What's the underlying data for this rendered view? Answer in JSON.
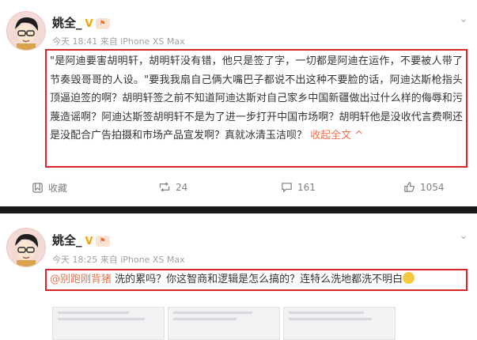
{
  "post1": {
    "username": "姚全_",
    "verified_badge": "V",
    "timestamp": "今天 18:41 来自 iPhone XS Max",
    "text": "\"是阿迪要害胡明轩，胡明轩没有错，他只是签了字，一切都是阿迪在运作，不要被人带了节奏毁哥哥的人设。\"要我我扇自己俩大嘴巴子都说不出这种不要脸的话，阿迪达斯枪指头顶逼迫签的啊？胡明轩签之前不知道阿迪达斯对自己家乡中国新疆做出过什么样的侮辱和污蔑造谣啊？阿迪达斯签胡明轩不是为了进一步打开中国市场啊？胡明轩他是没收代言费啊还是没配合广告拍摄和市场产品宣发啊？真就冰清玉洁呗？",
    "collapse_label": "收起全文 ^",
    "actions": {
      "favorite_label": "收藏",
      "repost_count": "24",
      "comment_count": "161",
      "like_count": "1054"
    }
  },
  "post2": {
    "username": "姚全_",
    "verified_badge": "V",
    "timestamp": "今天 18:25 来自 iPhone XS Max",
    "mention": "@别跑刚背猪",
    "text": " 洗的累吗？你这智商和逻辑是怎么搞的？连特么洗地都洗不明白"
  },
  "colors": {
    "highlight_box": "#d9262b",
    "link_accent": "#eb7350",
    "verified_gold": "#f7a400",
    "divider": "#1a1a1a"
  },
  "icons": [
    "avatar-cartoon",
    "verified-v-icon",
    "level-badge-icon",
    "chevron-down-icon",
    "favorite-icon",
    "repost-icon",
    "comment-icon",
    "like-icon",
    "emoji-icon"
  ]
}
